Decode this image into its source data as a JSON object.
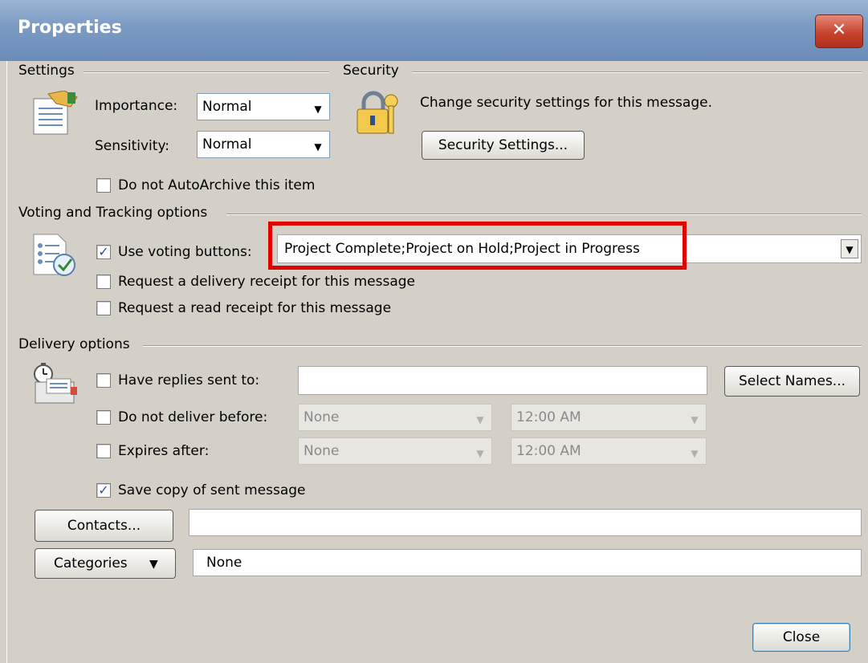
{
  "window": {
    "title": "Properties",
    "close_glyph": "✕"
  },
  "settings": {
    "group_label": "Settings",
    "importance_label": "Importance:",
    "importance_value": "Normal",
    "sensitivity_label": "Sensitivity:",
    "sensitivity_value": "Normal",
    "autoarchive_label": "Do not AutoArchive this item",
    "autoarchive_checked": false
  },
  "security": {
    "group_label": "Security",
    "description": "Change security settings for this message.",
    "button_label": "Security Settings..."
  },
  "voting": {
    "group_label": "Voting and Tracking options",
    "use_voting_label": "Use voting buttons:",
    "use_voting_checked": true,
    "voting_value": "Project Complete;Project on Hold;Project in Progress",
    "delivery_receipt_label": "Request a delivery receipt for this message",
    "read_receipt_label": "Request a read receipt for this message"
  },
  "delivery": {
    "group_label": "Delivery options",
    "replies_label": "Have replies sent to:",
    "replies_value": "",
    "select_names_label": "Select Names...",
    "not_before_label": "Do not deliver before:",
    "not_before_date": "None",
    "not_before_time": "12:00 AM",
    "expires_label": "Expires after:",
    "expires_date": "None",
    "expires_time": "12:00 AM",
    "save_copy_label": "Save copy of sent message",
    "save_copy_checked": true
  },
  "contacts": {
    "button_label": "Contacts...",
    "value": ""
  },
  "categories": {
    "button_label": "Categories",
    "value": "None"
  },
  "footer": {
    "close_label": "Close"
  },
  "colors": {
    "highlight": "#e00000",
    "title_text": "#ffffff",
    "check": "#2a4fa8"
  }
}
